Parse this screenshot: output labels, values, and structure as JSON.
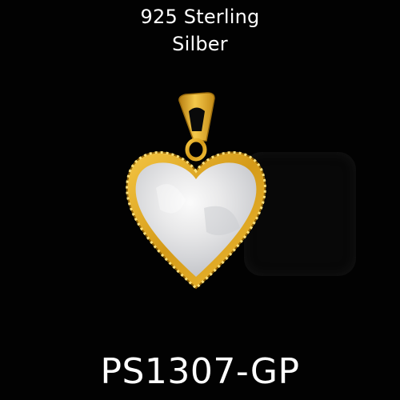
{
  "caption": {
    "line1": "925 Sterling",
    "line2": "Silber"
  },
  "product_code": "PS1307-GP",
  "colors": {
    "background": "#020202",
    "text": "#ffffff",
    "gold": "#d9a521",
    "pearl": "#e7e7e7"
  }
}
